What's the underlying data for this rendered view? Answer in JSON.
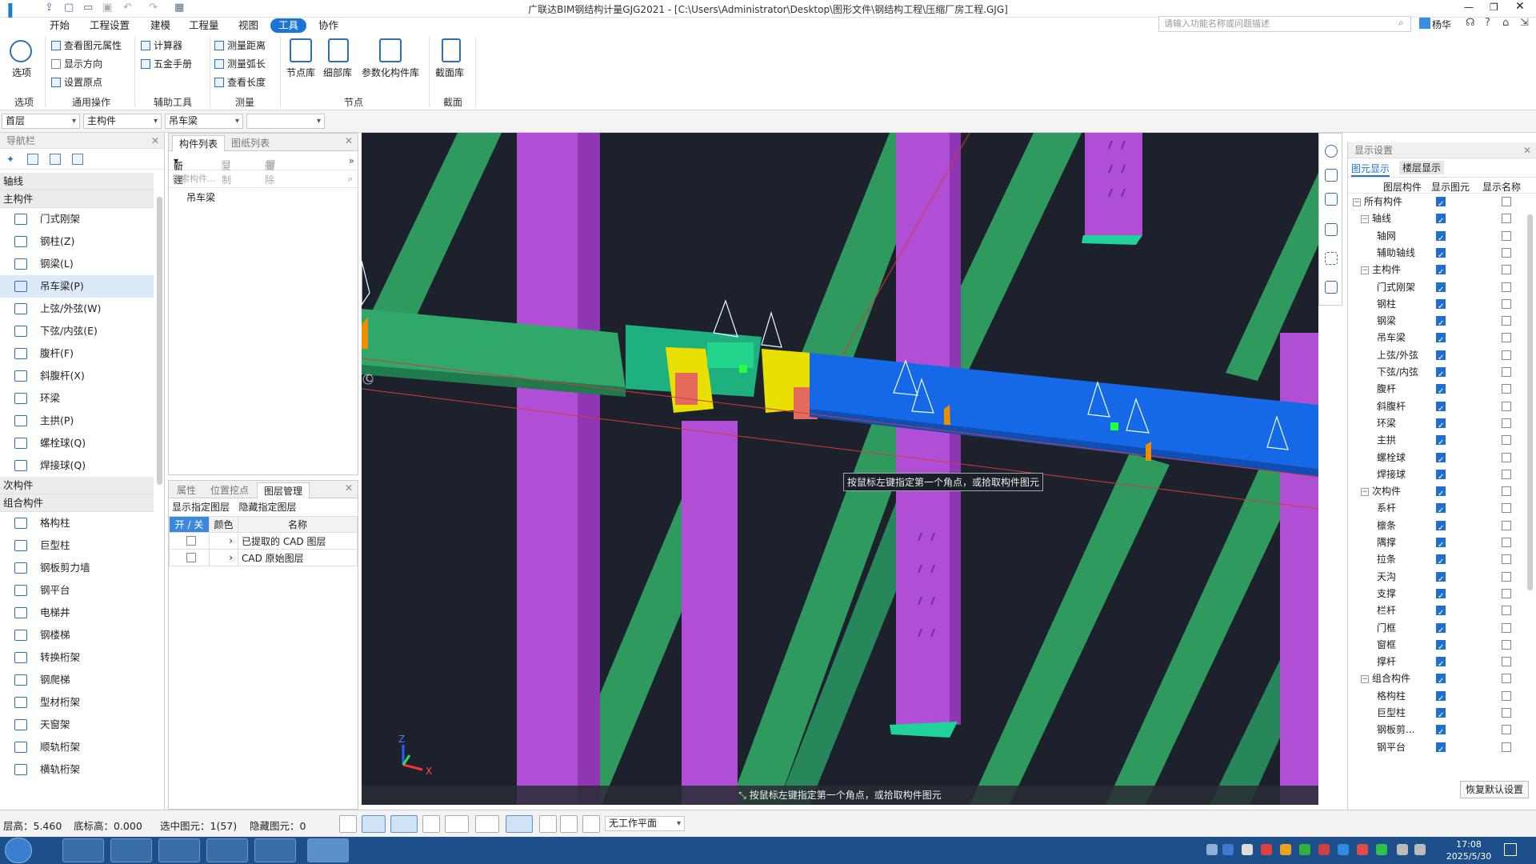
{
  "window": {
    "title": "广联达BIM钢结构计量GJG2021 - [C:\\Users\\Administrator\\Desktop\\图形文件\\钢结构工程\\压缩厂房工程.GJG]"
  },
  "menu": [
    "开始",
    "工程设置",
    "建模",
    "工程量",
    "视图",
    "工具",
    "协作"
  ],
  "menu_active": "工具",
  "search": {
    "placeholder": "请输入功能名称或问题描述"
  },
  "user": {
    "name": "杨华"
  },
  "ribbon": {
    "options": "选项",
    "general": {
      "items": [
        "查看图元属性",
        "显示方向",
        "设置原点"
      ],
      "group": "通用操作"
    },
    "aux": {
      "items": [
        "计算器",
        "五金手册"
      ],
      "group": "辅助工具"
    },
    "measure": {
      "items": [
        "测量距离",
        "测量弧长",
        "查看长度"
      ],
      "group": "测量"
    },
    "nodes": {
      "items": [
        "节点库",
        "细部库",
        "参数化构件库"
      ],
      "group": "节点"
    },
    "section": {
      "items": [
        "截面库"
      ],
      "group": "截面"
    },
    "options_group": "选项"
  },
  "filters": {
    "floor": "首层",
    "type": "主构件",
    "comp": "吊车梁",
    "extra": ""
  },
  "nav": {
    "title": "导航栏",
    "sec_axis": "轴线",
    "sec_main": "主构件",
    "main_items": [
      "门式刚架",
      "钢柱(Z)",
      "钢梁(L)",
      "吊车梁(P)",
      "上弦/外弦(W)",
      "下弦/内弦(E)",
      "腹杆(F)",
      "斜腹杆(X)",
      "环梁",
      "主拱(P)",
      "螺栓球(Q)",
      "焊接球(Q)"
    ],
    "sec_sub": "次构件",
    "sec_combo": "组合构件",
    "combo_items": [
      "格构柱",
      "巨型柱",
      "钢板剪力墙",
      "钢平台",
      "电梯井",
      "钢楼梯",
      "转换桁架",
      "钢爬梯",
      "型材桁架",
      "天窗架",
      "顺轨桁架",
      "横轨桁架"
    ]
  },
  "complist": {
    "tabs": [
      "构件列表",
      "图纸列表"
    ],
    "tools": [
      "新建",
      "复制",
      "删除"
    ],
    "search_placeholder": "搜索构件...",
    "items": [
      "吊车梁"
    ]
  },
  "props": {
    "tabs": [
      "属性",
      "位置挖点",
      "图层管理"
    ],
    "show": "显示指定图层",
    "hide": "隐藏指定图层",
    "headers": [
      "开 / 关",
      "颜色",
      "名称"
    ],
    "rows": [
      {
        "name": "已提取的 CAD 图层"
      },
      {
        "name": "CAD 原始图层"
      }
    ]
  },
  "viewport": {
    "tip": "按鼠标左键指定第一个角点，或拾取构件图元",
    "bottom_hint": "按鼠标左键指定第一个角点，或拾取构件图元",
    "label_c": "C"
  },
  "display": {
    "title": "显示设置",
    "tabs": [
      "图元显示",
      "楼层显示"
    ],
    "headers": [
      "图层构件",
      "显示图元",
      "显示名称"
    ],
    "rows": [
      {
        "name": "所有构件",
        "lvl": 0,
        "minus": true,
        "a": true,
        "b": false
      },
      {
        "name": "轴线",
        "lvl": 1,
        "minus": true,
        "a": true,
        "b": false
      },
      {
        "name": "轴网",
        "lvl": 2,
        "a": true,
        "b": false
      },
      {
        "name": "辅助轴线",
        "lvl": 2,
        "a": true,
        "b": false
      },
      {
        "name": "主构件",
        "lvl": 1,
        "minus": true,
        "a": true,
        "b": false
      },
      {
        "name": "门式刚架",
        "lvl": 2,
        "a": true,
        "b": false
      },
      {
        "name": "钢柱",
        "lvl": 2,
        "a": true,
        "b": false
      },
      {
        "name": "钢梁",
        "lvl": 2,
        "a": true,
        "b": false
      },
      {
        "name": "吊车梁",
        "lvl": 2,
        "a": true,
        "b": false
      },
      {
        "name": "上弦/外弦",
        "lvl": 2,
        "a": true,
        "b": false
      },
      {
        "name": "下弦/内弦",
        "lvl": 2,
        "a": true,
        "b": false
      },
      {
        "name": "腹杆",
        "lvl": 2,
        "a": true,
        "b": false
      },
      {
        "name": "斜腹杆",
        "lvl": 2,
        "a": true,
        "b": false
      },
      {
        "name": "环梁",
        "lvl": 2,
        "a": true,
        "b": false
      },
      {
        "name": "主拱",
        "lvl": 2,
        "a": true,
        "b": false
      },
      {
        "name": "螺栓球",
        "lvl": 2,
        "a": true,
        "b": false
      },
      {
        "name": "焊接球",
        "lvl": 2,
        "a": true,
        "b": false
      },
      {
        "name": "次构件",
        "lvl": 1,
        "minus": true,
        "a": true,
        "b": false
      },
      {
        "name": "系杆",
        "lvl": 2,
        "a": true,
        "b": false
      },
      {
        "name": "檩条",
        "lvl": 2,
        "a": true,
        "b": false
      },
      {
        "name": "隅撑",
        "lvl": 2,
        "a": true,
        "b": false
      },
      {
        "name": "拉条",
        "lvl": 2,
        "a": true,
        "b": false
      },
      {
        "name": "天沟",
        "lvl": 2,
        "a": true,
        "b": false
      },
      {
        "name": "支撑",
        "lvl": 2,
        "a": true,
        "b": false
      },
      {
        "name": "栏杆",
        "lvl": 2,
        "a": true,
        "b": false
      },
      {
        "name": "门框",
        "lvl": 2,
        "a": true,
        "b": false
      },
      {
        "name": "窗框",
        "lvl": 2,
        "a": true,
        "b": false
      },
      {
        "name": "撑杆",
        "lvl": 2,
        "a": true,
        "b": false
      },
      {
        "name": "组合构件",
        "lvl": 1,
        "minus": true,
        "a": true,
        "b": false
      },
      {
        "name": "格构柱",
        "lvl": 2,
        "a": true,
        "b": false
      },
      {
        "name": "巨型柱",
        "lvl": 2,
        "a": true,
        "b": false
      },
      {
        "name": "钢板剪...",
        "lvl": 2,
        "a": true,
        "b": false
      },
      {
        "name": "钢平台",
        "lvl": 2,
        "a": true,
        "b": false
      }
    ],
    "reset": "恢复默认设置"
  },
  "status": {
    "floor_height": "层高：5.460",
    "bottom_elev": "底标高：0.000",
    "selected": "选中图元：1(57)",
    "hidden": "隐藏图元：0",
    "workplane": "无工作平面"
  },
  "taskbar": {
    "time": "17:08",
    "date": "2025/5/30"
  }
}
